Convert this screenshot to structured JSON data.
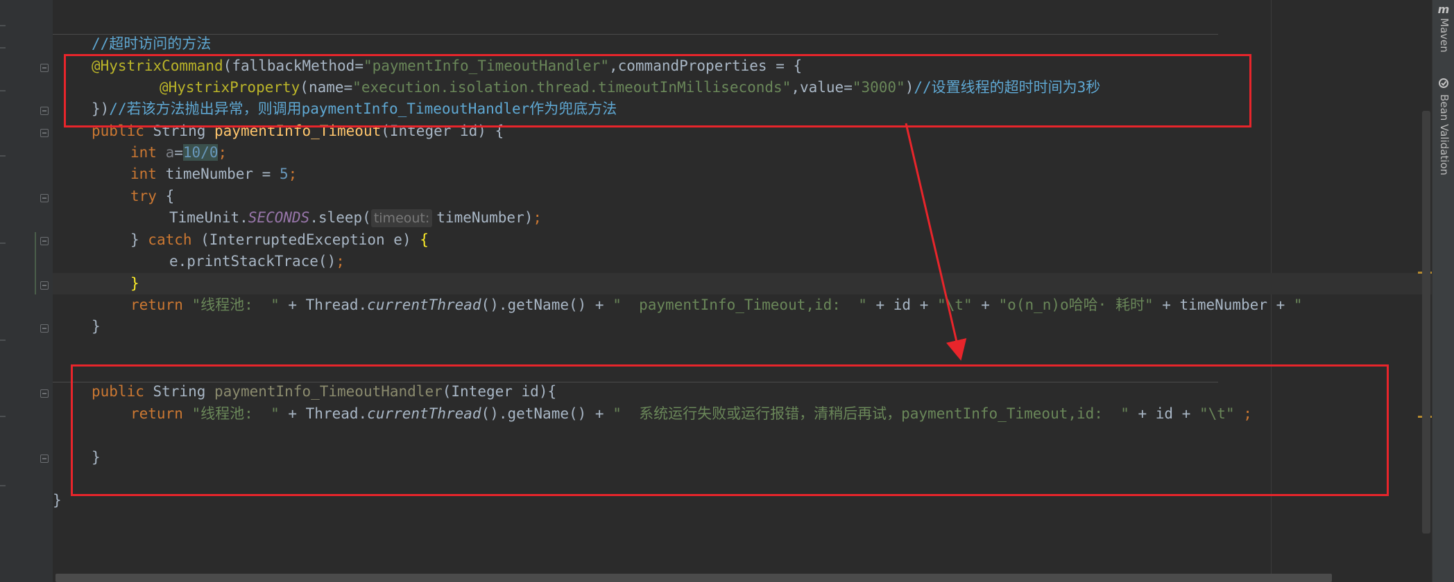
{
  "editor": {
    "lines": {
      "l1_comment": "//超时访问的方法",
      "l2_annotation": "@HystrixCommand",
      "l2_paren": "(",
      "l2_param": "fallbackMethod=",
      "l2_value": "\"paymentInfo_TimeoutHandler\"",
      "l2_rest": ",commandProperties = {",
      "l3_annotation": "@HystrixProperty",
      "l3_paren": "(",
      "l3_name": "name=",
      "l3_name_value": "\"execution.isolation.thread.timeoutInMilliseconds\"",
      "l3_comma": ",",
      "l3_value_key": "value=",
      "l3_value": "\"3000\"",
      "l3_close": ")",
      "l3_comment": "//设置线程的超时时间为3秒",
      "l4_close": "})",
      "l4_comment": "//若该方法抛出异常，则调用paymentInfo_TimeoutHandler作为兜底方法",
      "l5_kw": "public",
      "l5_type": " String ",
      "l5_fn": "paymentInfo_Timeout",
      "l5_rest": "(Integer id) {",
      "l6_kw": "int",
      "l6_var": " a",
      "l6_eq": "=",
      "l6_expr": "10/0",
      "l6_semi": ";",
      "l7_kw": "int",
      "l7_rest": " timeNumber = ",
      "l7_num": "5",
      "l7_semi": ";",
      "l8_kw": "try",
      "l8_rest": " {",
      "l9_class": "TimeUnit.",
      "l9_const": "SECONDS",
      "l9_call": ".sleep(",
      "l9_hint": "timeout:",
      "l9_arg": "timeNumber)",
      "l9_semi": ";",
      "l10_brace": "} ",
      "l10_kw": "catch",
      "l10_rest": " (InterruptedException e) ",
      "l10_open": "{",
      "l11_call": "e.printStackTrace()",
      "l11_semi": ";",
      "l12_brace": "}",
      "l13_kw": "return",
      "l13_str1": "\"线程池:  \"",
      "l13_plus1": " + Thread.",
      "l13_call": "currentThread",
      "l13_rest1": "().getName() + ",
      "l13_str2": "\"  paymentInfo_Timeout,id:  \"",
      "l13_rest2": " + id + ",
      "l13_str3": "\"\\t\"",
      "l13_plus2": " + ",
      "l13_str4": "\"o(n_n)o哈哈· 耗时\"",
      "l13_rest3": " + timeNumber + ",
      "l13_str5": "\"",
      "l14_brace": "}",
      "l16_kw": "public",
      "l16_type": " String ",
      "l16_fn": "paymentInfo_TimeoutHandler",
      "l16_rest": "(Integer id){",
      "l17_kw": "return",
      "l17_str1": "\"线程池:  \"",
      "l17_plus1": " + Thread.",
      "l17_call": "currentThread",
      "l17_rest1": "().getName() + ",
      "l17_str2": "\"  系统运行失败或运行报错，清稍后再试，paymentInfo_Timeout,id:  \"",
      "l17_rest2": " + id + ",
      "l17_str3": "\"\\t\"",
      "l17_semi": " ;",
      "l19_brace": "}",
      "l21_brace": "}"
    }
  },
  "side_panel": {
    "maven_icon": "m",
    "maven_label": "Maven",
    "bean_label": "Bean Validation",
    "bean_icon_name": "bean-validation-icon"
  },
  "colors": {
    "annotation_box": "#e8252b",
    "background": "#2b2b2b"
  }
}
